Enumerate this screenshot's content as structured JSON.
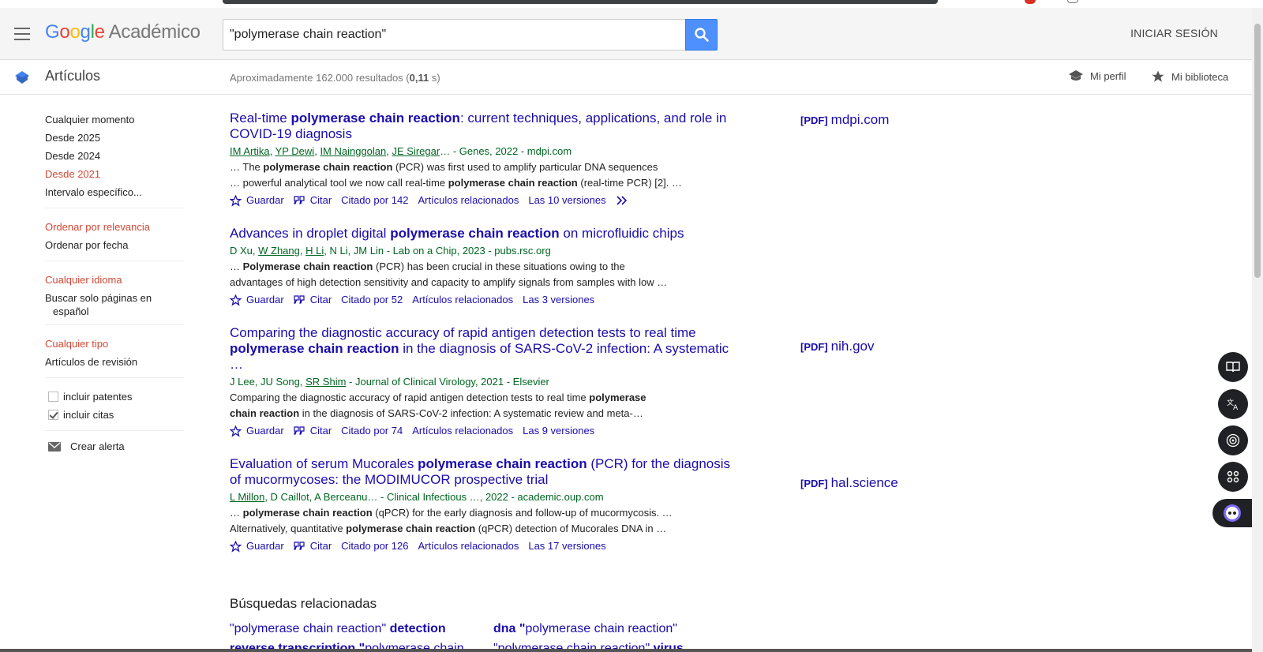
{
  "header": {
    "logo_google": [
      "G",
      "o",
      "o",
      "g",
      "l",
      "e"
    ],
    "logo_suffix": "Académico",
    "search_value": "\"polymerase chain reaction\"",
    "signin": "INICIAR SESIÓN"
  },
  "subbar": {
    "title": "Artículos",
    "count_prefix": "Aproximadamente 162.000 resultados (",
    "count_time": "0,11",
    "count_suffix": " s)",
    "my_profile": "Mi perfil",
    "my_library": "Mi biblioteca"
  },
  "sidebar": {
    "time": [
      "Cualquier momento",
      "Desde 2025",
      "Desde 2024",
      "Desde 2021",
      "Intervalo específico..."
    ],
    "sort": [
      "Ordenar por relevancia",
      "Ordenar por fecha"
    ],
    "lang_any": "Cualquier idioma",
    "lang_only_1": "Buscar solo páginas en",
    "lang_only_2": "español",
    "type_any": "Cualquier tipo",
    "type_review": "Artículos de revisión",
    "include_patents": "incluir patentes",
    "include_citations": "incluir citas",
    "create_alert": "Crear alerta"
  },
  "results": [
    {
      "title_a": "Real-time ",
      "title_b": "polymerase chain reaction",
      "title_c": ": current techniques, applications, and role in COVID-19 diagnosis",
      "meta_authors": [
        "IM Artika",
        "YP Dewi",
        "IM Nainggolan",
        "JE Siregar"
      ],
      "meta_rest": "… - Genes, 2022 - mdpi.com",
      "snip1_a": "… The ",
      "snip1_b": "polymerase chain reaction",
      "snip1_c": " (PCR) was first used to amplify particular DNA sequences",
      "snip2_a": "… powerful analytical tool we now call real-time ",
      "snip2_b": "polymerase chain reaction",
      "snip2_c": " (real-time PCR) [2]. …",
      "save": "Guardar",
      "cite": "Citar",
      "cited": "Citado por 142",
      "related": "Artículos relacionados",
      "versions": "Las 10 versiones",
      "side_pdf": "[PDF]",
      "side_domain": "mdpi.com"
    },
    {
      "title_a": "Advances in droplet digital ",
      "title_b": "polymerase chain reaction",
      "title_c": " on microfluidic chips",
      "meta_d": "D Xu, ",
      "meta_w": "W Zhang",
      "meta_h": "H Li",
      "meta_rest": ", N Li, JM Lin - Lab on a Chip, 2023 - pubs.rsc.org",
      "snip1_a": "… ",
      "snip1_b": "Polymerase chain reaction",
      "snip1_c": " (PCR) has been crucial in these situations owing to the",
      "snip2": "advantages of high detection sensitivity and capacity to amplify signals from samples with low …",
      "save": "Guardar",
      "cite": "Citar",
      "cited": "Citado por 52",
      "related": "Artículos relacionados",
      "versions": "Las 3 versiones"
    },
    {
      "title_a": "Comparing the diagnostic accuracy of rapid antigen detection tests to real time ",
      "title_b": "polymerase chain reaction",
      "title_c": " in the diagnosis of SARS-CoV-2 infection: A systematic …",
      "meta_a": "J Lee, JU Song, ",
      "meta_u": "SR Shim",
      "meta_rest": " - Journal of Clinical Virology, 2021 - Elsevier",
      "snip1_a": "Comparing the diagnostic accuracy of rapid antigen detection tests to real time ",
      "snip1_b": "polymerase",
      "snip2_b": "chain reaction",
      "snip2_c": " in the diagnosis of SARS-CoV-2 infection: A systematic review and meta-…",
      "save": "Guardar",
      "cite": "Citar",
      "cited": "Citado por 74",
      "related": "Artículos relacionados",
      "versions": "Las 9 versiones",
      "side_pdf": "[PDF]",
      "side_domain": "nih.gov"
    },
    {
      "title_a": "Evaluation of serum Mucorales ",
      "title_b": "polymerase chain reaction",
      "title_c": " (PCR) for the diagnosis of mucormycoses: the MODIMUCOR prospective trial",
      "meta_u": "L Millon",
      "meta_rest": ", D Caillot, A Berceanu… - Clinical Infectious …, 2022 - academic.oup.com",
      "snip1_a": "… ",
      "snip1_b": "polymerase chain reaction",
      "snip1_c": " (qPCR) for the early diagnosis and follow-up of mucormycosis. …",
      "snip2_a": "Alternatively, quantitative ",
      "snip2_b": "polymerase chain reaction",
      "snip2_c": " (qPCR) detection of Mucorales DNA in …",
      "save": "Guardar",
      "cite": "Citar",
      "cited": "Citado por 126",
      "related": "Artículos relacionados",
      "versions": "Las 17 versiones",
      "side_pdf": "[PDF]",
      "side_domain": "hal.science"
    }
  ],
  "related_searches": {
    "title": "Búsquedas relacionadas",
    "q1_a": "\"polymerase chain reaction\" ",
    "q1_b": "detection",
    "q2_a": "dna \"",
    "q2_b": "polymerase chain reaction\"",
    "q3_a": "reverse transcription \"",
    "q3_b": "polymerase chain",
    "q4_a": "\"polymerase chain reaction\" ",
    "q4_b": "virus"
  },
  "colors": {
    "link": "#1a0dab",
    "meta": "#006621",
    "active": "#d14836",
    "search_button": "#4d90fe"
  }
}
